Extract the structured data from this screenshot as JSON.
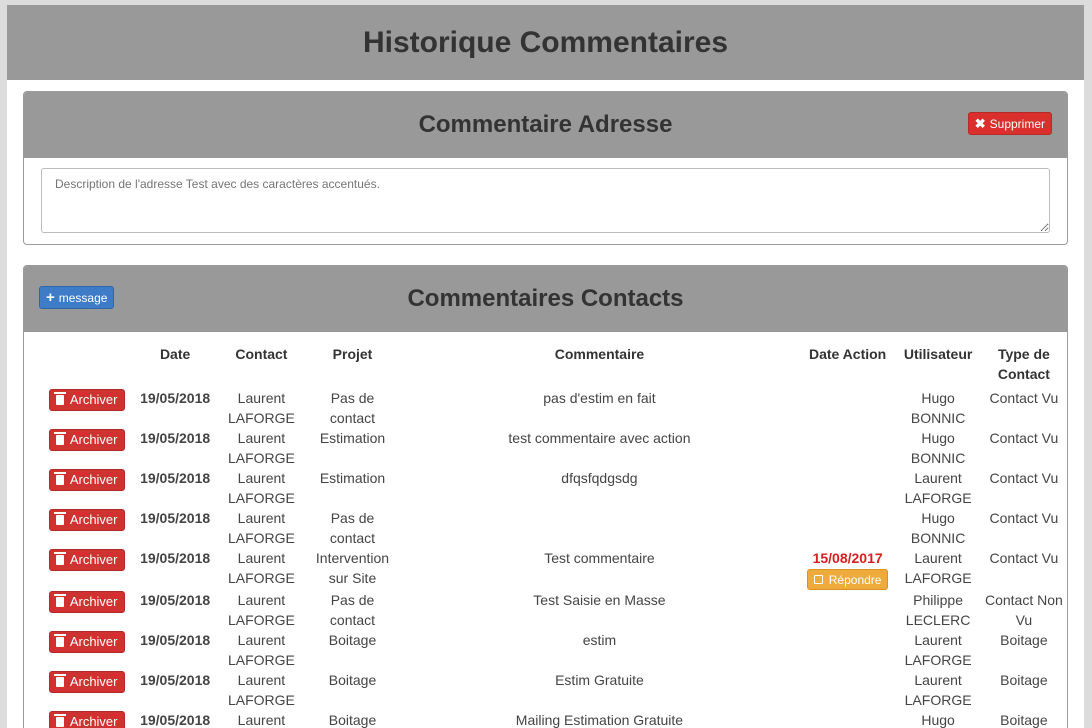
{
  "page_title": "Historique Commentaires",
  "address_panel": {
    "title": "Commentaire Adresse",
    "delete_label": "Supprimer",
    "description": "Description de l'adresse Test avec des caractères accentués."
  },
  "contacts_panel": {
    "title": "Commentaires Contacts",
    "add_label": "message",
    "headers": {
      "date": "Date",
      "contact": "Contact",
      "projet": "Projet",
      "commentaire": "Commentaire",
      "date_action": "Date Action",
      "utilisateur": "Utilisateur",
      "type_contact": "Type de Contact"
    },
    "archive_label": "Archiver",
    "reply_label": "Répondre",
    "rows": [
      {
        "date": "19/05/2018",
        "contact": "Laurent LAFORGE",
        "projet": "Pas de contact",
        "commentaire": "pas d'estim en fait",
        "date_action": "",
        "utilisateur": "Hugo BONNIC",
        "type": "Contact Vu"
      },
      {
        "date": "19/05/2018",
        "contact": "Laurent LAFORGE",
        "projet": "Estimation",
        "commentaire": "test commentaire avec action",
        "date_action": "",
        "utilisateur": "Hugo BONNIC",
        "type": "Contact Vu"
      },
      {
        "date": "19/05/2018",
        "contact": "Laurent LAFORGE",
        "projet": "Estimation",
        "commentaire": "dfqsfqdgsdg",
        "date_action": "",
        "utilisateur": "Laurent LAFORGE",
        "type": "Contact Vu"
      },
      {
        "date": "19/05/2018",
        "contact": "Laurent LAFORGE",
        "projet": "Pas de contact",
        "commentaire": "",
        "date_action": "",
        "utilisateur": "Hugo BONNIC",
        "type": "Contact Vu"
      },
      {
        "date": "19/05/2018",
        "contact": "Laurent LAFORGE",
        "projet": "Intervention sur Site",
        "commentaire": "Test commentaire",
        "date_action": "15/08/2017",
        "utilisateur": "Laurent LAFORGE",
        "type": "Contact Vu"
      },
      {
        "date": "19/05/2018",
        "contact": "Laurent LAFORGE",
        "projet": "Pas de contact",
        "commentaire": "Test Saisie en Masse",
        "date_action": "",
        "utilisateur": "Philippe LECLERC",
        "type": "Contact Non Vu"
      },
      {
        "date": "19/05/2018",
        "contact": "Laurent LAFORGE",
        "projet": "Boitage",
        "commentaire": "estim",
        "date_action": "",
        "utilisateur": "Laurent LAFORGE",
        "type": "Boitage"
      },
      {
        "date": "19/05/2018",
        "contact": "Laurent LAFORGE",
        "projet": "Boitage",
        "commentaire": "Estim Gratuite",
        "date_action": "",
        "utilisateur": "Laurent LAFORGE",
        "type": "Boitage"
      },
      {
        "date": "19/05/2018",
        "contact": "Laurent LAFORGE",
        "projet": "Boitage",
        "commentaire": "Mailing Estimation Gratuite",
        "date_action": "",
        "utilisateur": "Hugo BONNIC",
        "type": "Boitage"
      }
    ]
  }
}
